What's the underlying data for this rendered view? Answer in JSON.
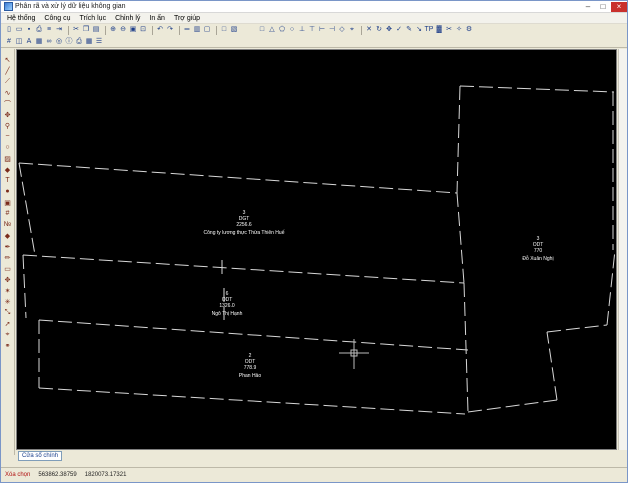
{
  "window": {
    "title": "Phân rã và xử lý dữ liệu không gian"
  },
  "menu": [
    "Hệ thống",
    "Công cụ",
    "Trích lục",
    "Chỉnh lý",
    "In ấn",
    "Trợ giúp"
  ],
  "toolbar1": {
    "left": [
      "new-file-icon",
      "open-folder-icon",
      "save-icon",
      "print-icon",
      "layers-icon",
      "export-icon",
      "|",
      "cut-icon",
      "copy-icon",
      "paste-icon",
      "|",
      "zoom-in-icon",
      "zoom-out-icon",
      "zoom-window-icon",
      "zoom-extent-icon",
      "|",
      "undo-icon",
      "redo-icon",
      "|",
      "ruler-icon",
      "area-icon",
      "select-icon",
      "|",
      "rect-select-icon",
      "rect-delete-icon"
    ],
    "right": [
      "square-tool-icon",
      "triangle-tool-icon",
      "polygon-tool-icon",
      "circle-tool-icon",
      "split-line-icon",
      "merge-icon",
      "trim-icon",
      "extend-icon",
      "node-icon",
      "snap-icon",
      "|",
      "delete-x-icon",
      "rotate-icon",
      "move-icon",
      "check-icon",
      "brush-icon",
      "color-picker-icon",
      "text-tool-icon",
      "fill-icon",
      "scissors-icon",
      "wand-icon",
      "settings-icon"
    ],
    "right_text": [
      "",
      "",
      "",
      "",
      "",
      "",
      "",
      "",
      "",
      "",
      "",
      "",
      "",
      "",
      "",
      "",
      "",
      "TP",
      "",
      "",
      "",
      ""
    ]
  },
  "toolbar2": [
    "grid-icon",
    "layer-toggle-icon",
    "label-icon",
    "parcel-icon",
    "link-icon",
    "target-icon",
    "info-icon",
    "print-preview-icon",
    "table-icon",
    "list-icon"
  ],
  "lefttoolbar": [
    "pointer-icon",
    "line-icon",
    "polyline-icon",
    "curve-icon",
    "arc-icon",
    "pan-icon",
    "zoom-icon",
    "spline-icon",
    "circle-icon",
    "hatch-icon",
    "node-edit-icon",
    "text-icon",
    "paint-icon",
    "stamp-icon",
    "grid-label-icon",
    "parcel-number-icon",
    "color-fill-icon",
    "pen-icon",
    "pencil-icon",
    "eraser-icon",
    "move-icon",
    "star-icon",
    "explode-icon",
    "scale-icon",
    "arrow-icon",
    "snap-icon",
    "attach-icon"
  ],
  "canvas": {
    "parcels": [
      {
        "number": "3",
        "type": "DGT",
        "area": "2256.6",
        "owner": "Công ty lương thực Thừa Thiên Huế"
      },
      {
        "number": "6",
        "type": "ODT",
        "area": "1326.0",
        "owner": "Ngô Thị Hạnh"
      },
      {
        "number": "2",
        "type": "ODT",
        "area": "778.9",
        "owner": "Phan Hảo"
      },
      {
        "number": "3",
        "type": "ODT",
        "area": "770",
        "owner": "Đỗ Xuân Nghị"
      }
    ]
  },
  "tabs": [
    "Cửa sổ chính"
  ],
  "status": {
    "mode": "Xóa chọn",
    "x": "563862.38759",
    "y": "1820073.17321"
  }
}
